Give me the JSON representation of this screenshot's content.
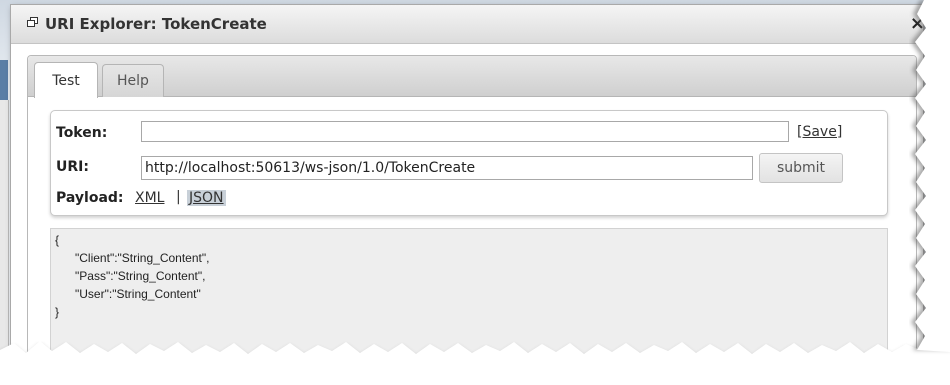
{
  "window": {
    "title": "URI Explorer: TokenCreate",
    "close_glyph": "×"
  },
  "tabs": [
    {
      "label": "Test",
      "active": true
    },
    {
      "label": "Help",
      "active": false
    }
  ],
  "form": {
    "token_label": "Token:",
    "token_value": "",
    "save_link": "[Save]",
    "uri_label": "URI:",
    "uri_value": "http://localhost:50613/ws-json/1.0/TokenCreate",
    "submit_label": "submit",
    "payload_label": "Payload:",
    "xml_link": "XML",
    "separator": "|",
    "json_link": "JSON"
  },
  "payload": {
    "lines": [
      "{",
      "      \"Client\":\"String_Content\",",
      "      \"Pass\":\"String_Content\",",
      "      \"User\":\"String_Content\"",
      "}"
    ]
  },
  "colors": {
    "dialog_border": "#a9a9a9",
    "payload_bg": "#eeeeee",
    "active_link_bg": "#c8d0d8"
  }
}
